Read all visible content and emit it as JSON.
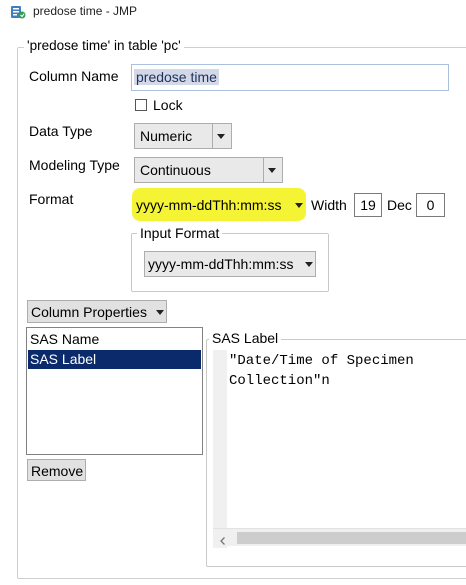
{
  "window": {
    "title": "predose time - JMP"
  },
  "dialog": {
    "group_title": "'predose time' in table 'pc'",
    "column_name_label": "Column Name",
    "column_name_value": "predose time",
    "lock_label": "Lock",
    "lock_checked": false,
    "data_type_label": "Data Type",
    "data_type_value": "Numeric",
    "modeling_type_label": "Modeling Type",
    "modeling_type_value": "Continuous",
    "format_label": "Format",
    "format_value": "yyyy-mm-ddThh:mm:ss",
    "width_label": "Width",
    "width_value": "19",
    "dec_label": "Dec",
    "dec_value": "0",
    "input_format_title": "Input Format",
    "input_format_value": "yyyy-mm-ddThh:mm:ss",
    "column_properties_label": "Column Properties",
    "properties_list": [
      "SAS Name",
      "SAS Label"
    ],
    "selected_property": "SAS Label",
    "remove_label": "Remove",
    "sas_label_title": "SAS Label",
    "sas_label_line1": "\"Date/Time of Specimen",
    "sas_label_line2": "Collection\"n"
  },
  "colors": {
    "highlight": "#f3f32a",
    "selection": "#0a2a6b",
    "selection_text": "#ffffff"
  },
  "icons": [
    "jmp-app-icon",
    "chevron-down-icon",
    "scroll-left-icon"
  ]
}
